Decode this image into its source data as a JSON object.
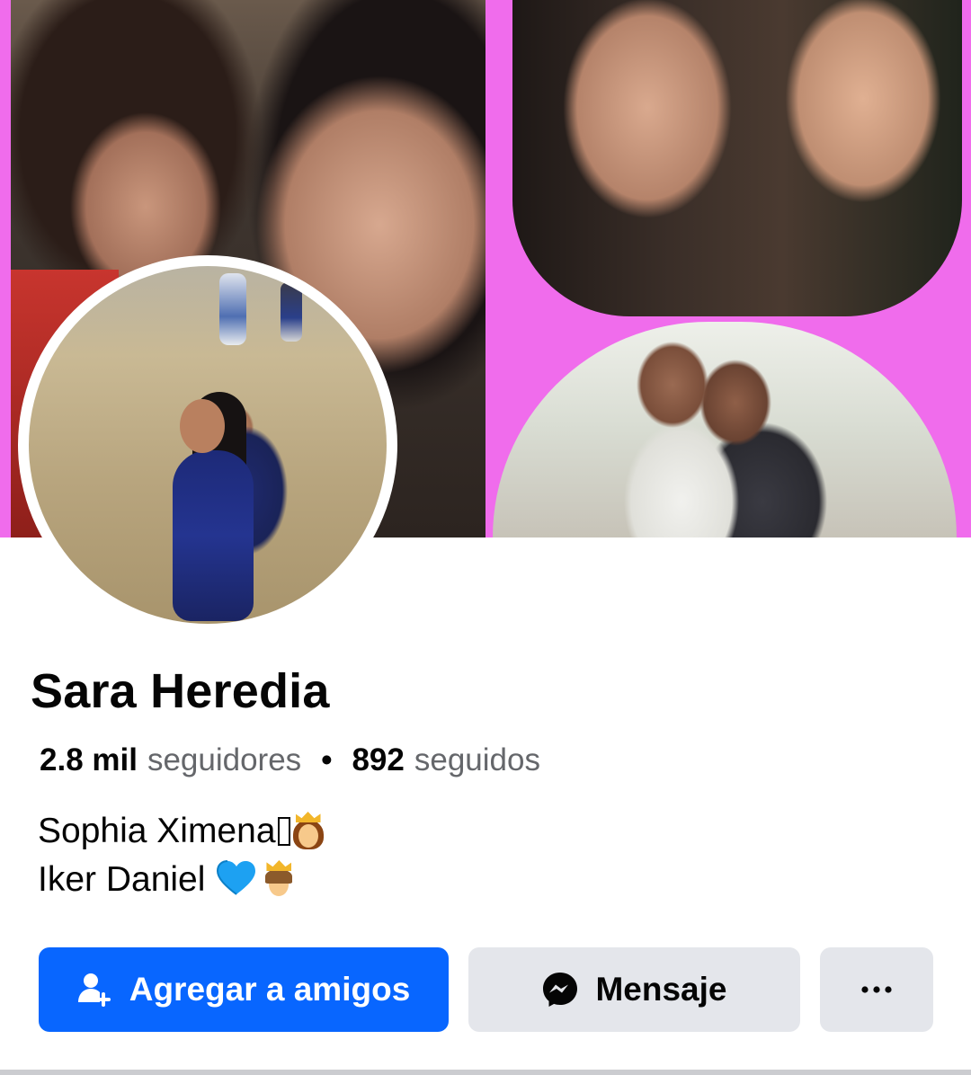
{
  "profile": {
    "name": "Sara Heredia",
    "stats": {
      "followers_count": "2.8 mil",
      "followers_label": "seguidores",
      "separator": "•",
      "following_count": "892",
      "following_label": "seguidos"
    },
    "bio": {
      "line1_text": "Sophia Ximena",
      "line1_emojis": [
        "unknown-glyph",
        "princess-emoji"
      ],
      "line2_text": "Iker Daniel",
      "line2_emojis": [
        "blue-heart-emoji",
        "prince-emoji"
      ]
    }
  },
  "actions": {
    "add_friend_label": "Agregar a amigos",
    "message_label": "Mensaje",
    "more_label": "···"
  },
  "colors": {
    "primary_button": "#0866ff",
    "secondary_button": "#e4e6eb",
    "cover_background": "#f06cec",
    "text_primary": "#050505",
    "text_secondary": "#65676b"
  },
  "icons": {
    "add_friend": "add-friend-icon",
    "messenger": "messenger-icon",
    "more": "more-dots-icon"
  }
}
